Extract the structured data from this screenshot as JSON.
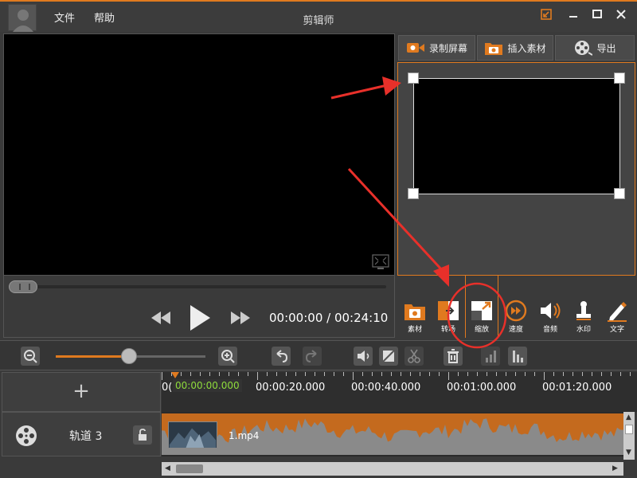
{
  "app": {
    "title": "剪辑师",
    "menu": [
      "文件",
      "帮助"
    ]
  },
  "window_controls": [
    "restore-down",
    "minimize",
    "maximize",
    "close"
  ],
  "player": {
    "time_readout": "00:00:00 / 00:24:10",
    "seek_progress": 0
  },
  "header_buttons": [
    {
      "label": "录制屏幕",
      "icon": "camera-record-icon"
    },
    {
      "label": "插入素材",
      "icon": "folder-camera-icon"
    },
    {
      "label": "导出",
      "icon": "film-reel-icon"
    }
  ],
  "tools": [
    {
      "label": "素材",
      "icon": "folder-camera-icon"
    },
    {
      "label": "转场",
      "icon": "transition-icon"
    },
    {
      "label": "缩放",
      "icon": "zoom-resize-icon",
      "selected": true
    },
    {
      "label": "速度",
      "icon": "speed-icon"
    },
    {
      "label": "音频",
      "icon": "speaker-icon"
    },
    {
      "label": "水印",
      "icon": "stamp-icon"
    },
    {
      "label": "文字",
      "icon": "pencil-icon"
    }
  ],
  "timeline": {
    "zoom_level": 0.49,
    "playhead_time": "00:00:00.000",
    "ruler_ticks": [
      "00:00:20.000",
      "00:00:40.000",
      "00:01:00.000",
      "00:01:20.000"
    ],
    "ruler_left_clip": "0(",
    "add_track": "+",
    "track": {
      "label": "轨道 3",
      "clip_name": "1.mp4"
    }
  },
  "colors": {
    "accent": "#e07a1f",
    "annotation_red": "#e8302a",
    "playhead_green": "#8fdc3c"
  }
}
